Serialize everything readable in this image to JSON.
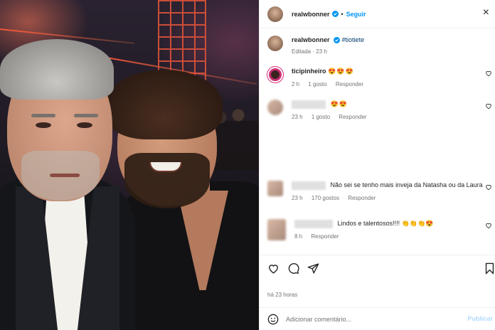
{
  "header": {
    "username": "realwbonner",
    "separator": "•",
    "follow_label": "Seguir",
    "close_glyph": "×"
  },
  "caption": {
    "username": "realwbonner",
    "text": "#tiotiete",
    "meta": "Editada · 23 h"
  },
  "comments": [
    {
      "username": "ticipinheiro",
      "text": "😍😍😍",
      "time": "2 h",
      "likes": "1 gosto",
      "reply": "Responder"
    },
    {
      "username": "",
      "text": "😍😍",
      "time": "23 h",
      "likes": "1 gosto",
      "reply": "Responder"
    },
    {
      "username": "",
      "text": "Não sei se tenho mais inveja da Natasha ou da Laura",
      "time": "23 h",
      "likes": "170 gostos",
      "reply": "Responder"
    },
    {
      "username": "",
      "text": "Lindos e talentosos!!!! 👏👏👏😍",
      "time": "8 h",
      "likes": "",
      "reply": "Responder"
    }
  ],
  "post": {
    "time_ago": "há 23 horas"
  },
  "add_comment": {
    "placeholder": "Adicionar comentário...",
    "publish_label": "Publicar"
  },
  "icons": {
    "verified": "verified-badge-icon",
    "like": "heart-icon",
    "comment": "comment-icon",
    "share": "share-icon",
    "save": "bookmark-icon",
    "emoji": "emoji-icon"
  },
  "colors": {
    "accent": "#0095f6",
    "muted": "#737373",
    "hashtag": "#00376b"
  }
}
